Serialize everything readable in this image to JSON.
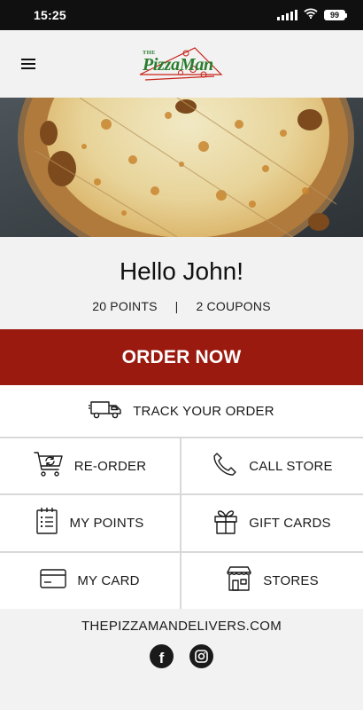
{
  "status_bar": {
    "time": "15:25",
    "battery_level": "99",
    "icons": [
      "signal-icon",
      "wifi-icon",
      "battery-icon"
    ]
  },
  "header": {
    "menu_icon": "hamburger-menu-icon",
    "logo": {
      "small_text": "THE",
      "main_text": "PizzaMan"
    }
  },
  "greeting": {
    "title": "Hello John!",
    "points": "20 POINTS",
    "separator": "|",
    "coupons": "2 COUPONS"
  },
  "order_now": {
    "label": "ORDER NOW"
  },
  "track_order": {
    "label": "TRACK YOUR ORDER",
    "icon": "delivery-truck-icon"
  },
  "actions": [
    {
      "label": "RE-ORDER",
      "icon": "cart-reorder-icon"
    },
    {
      "label": "CALL STORE",
      "icon": "phone-icon"
    },
    {
      "label": "MY POINTS",
      "icon": "points-checklist-icon"
    },
    {
      "label": "GIFT CARDS",
      "icon": "gift-icon"
    },
    {
      "label": "MY CARD",
      "icon": "credit-card-icon"
    },
    {
      "label": "STORES",
      "icon": "store-icon"
    }
  ],
  "footer": {
    "website": "THEPIZZAMANDELIVERS.COM",
    "social": [
      "facebook-icon",
      "instagram-icon"
    ]
  },
  "colors": {
    "brand_red": "#9b1a0f",
    "logo_green": "#2a7d2e",
    "status_bar": "#101010",
    "background": "#f2f2f2"
  }
}
